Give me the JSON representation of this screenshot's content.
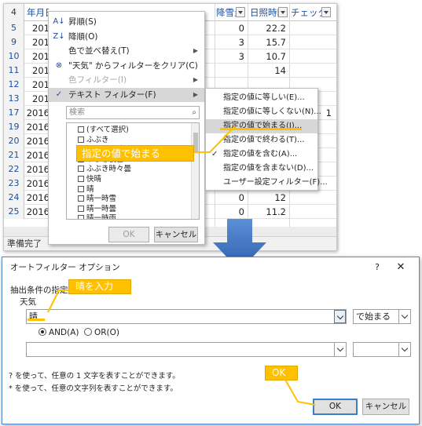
{
  "spreadsheet": {
    "corner_label": "4",
    "header": {
      "col_date": "年月日",
      "col_snow": "降雪量",
      "col_sun": "日照時間",
      "col_check": "チェック"
    },
    "rows": [
      {
        "num": "5",
        "date": "201",
        "snow": "0",
        "sun": "22.2",
        "check": ""
      },
      {
        "num": "9",
        "date": "201",
        "snow": "3",
        "sun": "15.7",
        "check": ""
      },
      {
        "num": "10",
        "date": "201",
        "snow": "3",
        "sun": "10.7",
        "check": ""
      },
      {
        "num": "11",
        "date": "201",
        "snow": "",
        "sun": "14",
        "check": ""
      },
      {
        "num": "12",
        "date": "201",
        "snow": "",
        "sun": "",
        "check": ""
      },
      {
        "num": "13",
        "date": "201",
        "snow": "",
        "sun": "",
        "check": ""
      },
      {
        "num": "17",
        "date": "2016",
        "snow": "",
        "sun": "",
        "check": "1"
      },
      {
        "num": "19",
        "date": "2016",
        "snow": "",
        "sun": "",
        "check": ""
      },
      {
        "num": "20",
        "date": "2016",
        "snow": "",
        "sun": "",
        "check": ""
      },
      {
        "num": "21",
        "date": "2016",
        "snow": "",
        "sun": "",
        "check": ""
      },
      {
        "num": "22",
        "date": "2016",
        "snow": "",
        "sun": "",
        "check": ""
      },
      {
        "num": "23",
        "date": "2016",
        "snow": "0",
        "sun": "13.8",
        "check": ""
      },
      {
        "num": "24",
        "date": "2016",
        "snow": "0",
        "sun": "12",
        "check": ""
      },
      {
        "num": "25",
        "date": "2016",
        "snow": "0",
        "sun": "11.2",
        "check": ""
      }
    ],
    "status": "準備完了"
  },
  "filter_menu": {
    "items": [
      {
        "label": "昇順(S)",
        "icon": "sort-asc-icon",
        "icon_glyph": "A↓",
        "arrow": false,
        "disabled": false
      },
      {
        "label": "降順(O)",
        "icon": "sort-desc-icon",
        "icon_glyph": "Z↓",
        "arrow": false,
        "disabled": false
      },
      {
        "label": "色で並べ替え(T)",
        "icon": "",
        "icon_glyph": "",
        "arrow": true,
        "disabled": false
      },
      {
        "label": "\"天気\" からフィルターをクリア(C)",
        "icon": "clear-filter-icon",
        "icon_glyph": "⊗",
        "arrow": false,
        "disabled": false
      },
      {
        "label": "色フィルター(I)",
        "icon": "",
        "icon_glyph": "",
        "arrow": true,
        "disabled": true
      },
      {
        "label": "テキスト フィルター(F)",
        "icon": "check-icon",
        "icon_glyph": "✓",
        "arrow": true,
        "disabled": false
      }
    ],
    "search_placeholder": "検索",
    "list_items": [
      {
        "label": "(すべて選択)",
        "checked": false
      },
      {
        "label": "ふぶき",
        "checked": false
      },
      {
        "label": "ふぶき一時雪",
        "checked": false
      },
      {
        "label": "ふぶき後曇",
        "checked": false
      },
      {
        "label": "ふぶき時々曇",
        "checked": false
      },
      {
        "label": "快晴",
        "checked": false
      },
      {
        "label": "晴",
        "checked": false
      },
      {
        "label": "晴一時雪",
        "checked": false
      },
      {
        "label": "晴一時曇",
        "checked": false
      },
      {
        "label": "晴一時雨",
        "checked": false
      }
    ],
    "ok_label": "OK",
    "cancel_label": "キャンセル"
  },
  "text_filter_submenu": {
    "items": [
      {
        "label": "指定の値に等しい(E)...",
        "highlight": false,
        "checked": false
      },
      {
        "label": "指定の値に等しくない(N)...",
        "highlight": false,
        "checked": false
      },
      {
        "label": "指定の値で始まる(I)...",
        "highlight": true,
        "checked": false
      },
      {
        "label": "指定の値で終わる(T)...",
        "highlight": false,
        "checked": false
      },
      {
        "label": "指定の値を含む(A)...",
        "highlight": false,
        "checked": true
      },
      {
        "label": "指定の値を含まない(D)...",
        "highlight": false,
        "checked": false
      },
      {
        "label": "ユーザー設定フィルター(F)...",
        "highlight": false,
        "checked": false
      }
    ]
  },
  "callouts": {
    "starts_with": "指定の値で始まる",
    "enter_text": "晴を入力",
    "ok": "OK"
  },
  "dialog": {
    "title": "オートフィルター オプション",
    "help": "?",
    "close": "✕",
    "criteria_label": "抽出条件の指定 :",
    "field_label": "天気",
    "value1": "晴",
    "operator1": "で始まる",
    "and_label": "AND(A)",
    "or_label": "OR(O)",
    "and_selected": true,
    "value2": "",
    "operator2": "",
    "hint1": "? を使って、任意の 1 文字を表すことができます。",
    "hint2": "* を使って、任意の文字列を表すことができます。",
    "ok_label": "OK",
    "cancel_label": "キャンセル"
  },
  "colors": {
    "accent_blue": "#1f4e9b",
    "callout_orange": "#ffc000",
    "arrow_blue": "#3b73c4"
  }
}
